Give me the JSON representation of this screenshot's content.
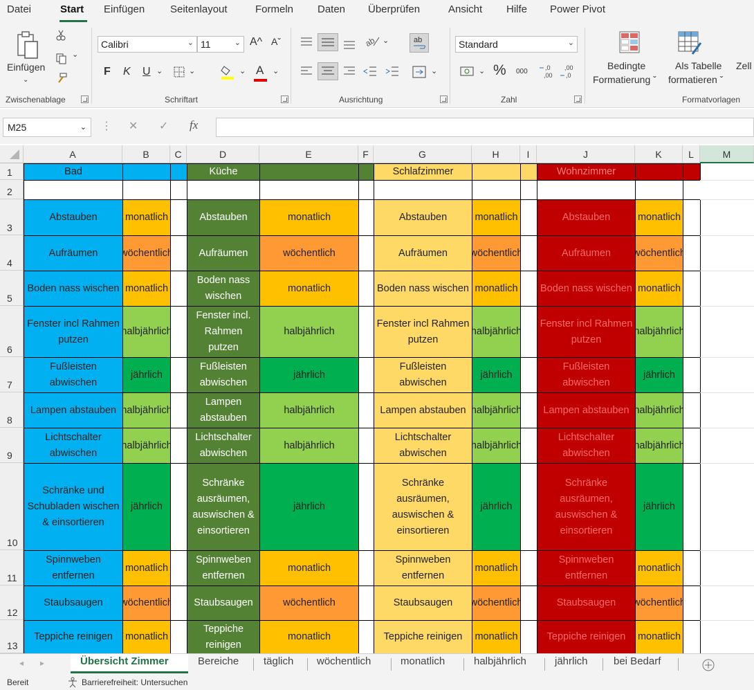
{
  "menu": {
    "tabs": [
      "Datei",
      "Start",
      "Einfügen",
      "Seitenlayout",
      "Formeln",
      "Daten",
      "Überprüfen",
      "Ansicht",
      "Hilfe",
      "Power Pivot"
    ],
    "active": "Start"
  },
  "ribbon": {
    "clipboard": {
      "paste_label": "Einfügen",
      "group_label": "Zwischenablage"
    },
    "font": {
      "name": "Calibri",
      "size": "11",
      "bold": "F",
      "italic": "K",
      "underline": "U",
      "grow": "A^",
      "shrink": "Aˇ",
      "font_color": "A",
      "group_label": "Schriftart"
    },
    "alignment": {
      "group_label": "Ausrichtung"
    },
    "number": {
      "format": "Standard",
      "percent": "%",
      "thousands": "000",
      "group_label": "Zahl"
    },
    "styles": {
      "conditional_line1": "Bedingte",
      "conditional_line2": "Formatierung ˇ",
      "table_line1": "Als Tabelle",
      "table_line2": "formatieren ˇ",
      "cell_partial": "Zell",
      "group_label": "Formatvorlagen"
    },
    "colors": {
      "font_color_bar": "#e00000",
      "fill_color_bar": "#ffff00"
    }
  },
  "formula_bar": {
    "name_box": "M25",
    "fx": "fx",
    "cancel": "✕",
    "confirm": "✓",
    "content": ""
  },
  "columns": [
    "A",
    "B",
    "C",
    "D",
    "E",
    "F",
    "G",
    "H",
    "I",
    "J",
    "K",
    "L",
    "M"
  ],
  "selected_column": "M",
  "rows": [
    "1",
    "2",
    "3",
    "4",
    "5",
    "6",
    "7",
    "8",
    "9",
    "10",
    "11",
    "12",
    "13"
  ],
  "headers": {
    "bad": "Bad",
    "kueche": "Küche",
    "schlafzimmer": "Schlafzimmer",
    "wohnzimmer": "Wohnzimmer"
  },
  "tasks": [
    {
      "bad": "Abstauben",
      "bad_freq": "monatlich",
      "kueche": "Abstauben",
      "kueche_freq": "monatlich",
      "schlaf": "Abstauben",
      "schlaf_freq": "monatlich",
      "wohn": "Abstauben",
      "wohn_freq": "monatlich"
    },
    {
      "bad": "Aufräumen",
      "bad_freq": "wöchentlich",
      "kueche": "Aufräumen",
      "kueche_freq": "wöchentlich",
      "schlaf": "Aufräumen",
      "schlaf_freq": "wöchentlich",
      "wohn": "Aufräumen",
      "wohn_freq": "wöchentlich"
    },
    {
      "bad": "Boden nass wischen",
      "bad_freq": "monatlich",
      "kueche": "Boden nass wischen",
      "kueche_freq": "monatlich",
      "schlaf": "Boden nass wischen",
      "schlaf_freq": "monatlich",
      "wohn": "Boden nass wischen",
      "wohn_freq": "monatlich"
    },
    {
      "bad": "Fenster incl Rahmen putzen",
      "bad_freq": "halbjährlich",
      "kueche": "Fenster incl. Rahmen putzen",
      "kueche_freq": "halbjährlich",
      "schlaf": "Fenster incl Rahmen putzen",
      "schlaf_freq": "halbjährlich",
      "wohn": "Fenster incl Rahmen putzen",
      "wohn_freq": "halbjährlich"
    },
    {
      "bad": "Fußleisten abwischen",
      "bad_freq": "jährlich",
      "kueche": "Fußleisten abwischen",
      "kueche_freq": "jährlich",
      "schlaf": "Fußleisten abwischen",
      "schlaf_freq": "jährlich",
      "wohn": "Fußleisten abwischen",
      "wohn_freq": "jährlich"
    },
    {
      "bad": "Lampen abstauben",
      "bad_freq": "halbjährlich",
      "kueche": "Lampen abstauben",
      "kueche_freq": "halbjährlich",
      "schlaf": "Lampen abstauben",
      "schlaf_freq": "halbjährlich",
      "wohn": "Lampen abstauben",
      "wohn_freq": "halbjährlich"
    },
    {
      "bad": "Lichtschalter abwischen",
      "bad_freq": "halbjährlich",
      "kueche": "Lichtschalter abwischen",
      "kueche_freq": "halbjährlich",
      "schlaf": "Lichtschalter abwischen",
      "schlaf_freq": "halbjährlich",
      "wohn": "Lichtschalter abwischen",
      "wohn_freq": "halbjährlich"
    },
    {
      "bad": "Schränke und Schubladen wischen & einsortieren",
      "bad_freq": "jährlich",
      "kueche": "Schränke ausräumen, auswischen & einsortieren",
      "kueche_freq": "jährlich",
      "schlaf": "Schränke ausräumen, auswischen & einsortieren",
      "schlaf_freq": "jährlich",
      "wohn": "Schränke ausräumen, auswischen & einsortieren",
      "wohn_freq": "jährlich"
    },
    {
      "bad": "Spinnweben entfernen",
      "bad_freq": "monatlich",
      "kueche": "Spinnweben entfernen",
      "kueche_freq": "monatlich",
      "schlaf": "Spinnweben entfernen",
      "schlaf_freq": "monatlich",
      "wohn": "Spinnweben entfernen",
      "wohn_freq": "monatlich"
    },
    {
      "bad": "Staubsaugen",
      "bad_freq": "wöchentlich",
      "kueche": "Staubsaugen",
      "kueche_freq": "wöchentlich",
      "schlaf": "Staubsaugen",
      "schlaf_freq": "wöchentlich",
      "wohn": "Staubsaugen",
      "wohn_freq": "wöchentlich"
    },
    {
      "bad": "Teppiche reinigen",
      "bad_freq": "monatlich",
      "kueche": "Teppiche reinigen",
      "kueche_freq": "monatlich",
      "schlaf": "Teppiche reinigen",
      "schlaf_freq": "monatlich",
      "wohn": "Teppiche reinigen",
      "wohn_freq": "monatlich"
    }
  ],
  "room_colors": {
    "bad": "#00b0f0",
    "kueche": "#548235",
    "schlaf": "#ffd966",
    "wohn": "#c00000"
  },
  "freq_colors": {
    "monatlich": "#ffc000",
    "wöchentlich": "#ff9933",
    "halbjährlich": "#92d050",
    "jährlich": "#00b050"
  },
  "sheet_tabs": [
    "Übersicht Zimmer",
    "Bereiche",
    "täglich",
    "wöchentlich",
    "monatlich",
    "halbjährlich",
    "jährlich",
    "bei Bedarf"
  ],
  "active_sheet": "Übersicht Zimmer",
  "status": {
    "ready": "Bereit",
    "accessibility": "Barrierefreiheit: Untersuchen"
  }
}
